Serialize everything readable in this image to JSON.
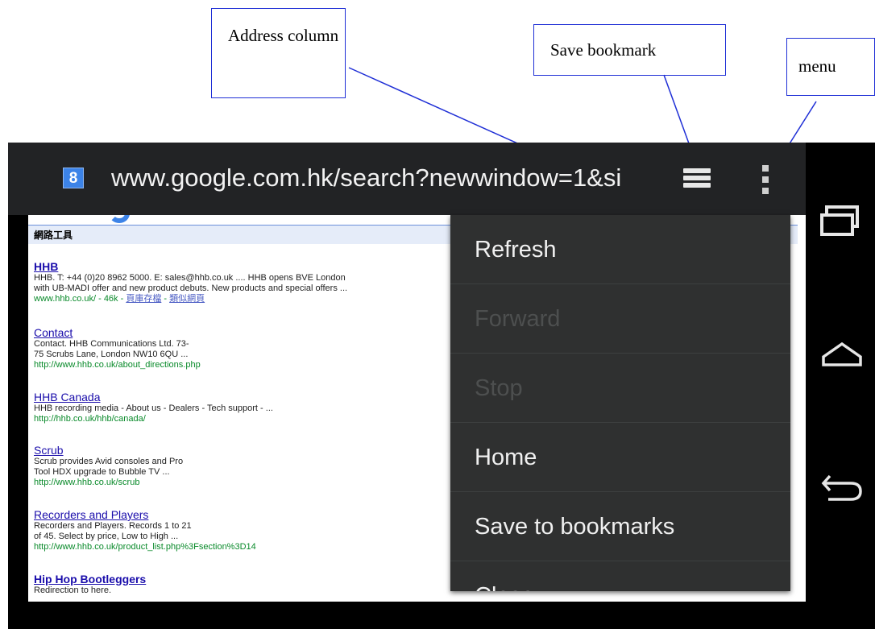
{
  "annotations": {
    "address": "Address column",
    "save": "Save bookmark",
    "menu": "menu"
  },
  "toolbar": {
    "favicon_text": "8",
    "url": "www.google.com.hk/search?newwindow=1&si"
  },
  "page": {
    "tools_label": "網路工具",
    "results": [
      {
        "title": "HHB",
        "snippet_1": "HHB. T: +44 (0)20 8962 5000. E: sales@hhb.co.uk .... HHB opens BVE London",
        "snippet_2": "with UB-MADI offer and new product debuts. New products and special offers ...",
        "url": "www.hhb.co.uk/ - 46k - ",
        "cache": "頁庫存檔",
        "sep": " - ",
        "similar": "類似網頁"
      },
      {
        "title": "Contact",
        "snippet_1": "Contact. HHB Communications Ltd. 73-",
        "snippet_2": "75 Scrubs Lane, London NW10 6QU ...",
        "url": "http://www.hhb.co.uk/about_directions.php"
      },
      {
        "title": "HHB Canada",
        "snippet_1": "HHB recording media - About us - Dealers - Tech support - ...",
        "url": "http://hhb.co.uk/hhb/canada/"
      },
      {
        "title": "Scrub",
        "snippet_1": "Scrub provides Avid consoles and Pro",
        "snippet_2": "Tool HDX upgrade to Bubble TV ...",
        "url": "http://www.hhb.co.uk/scrub"
      },
      {
        "title": "Recorders and Players",
        "snippet_1": "Recorders and Players. Records 1 to 21",
        "snippet_2": "of 45. Select by price, Low to High ...",
        "url": "http://www.hhb.co.uk/product_list.php%3Fsection%3D14"
      },
      {
        "title": "Hip Hop Bootleggers",
        "snippet_1": "Redirection to here."
      }
    ]
  },
  "menu": {
    "items": [
      "Refresh",
      "Forward",
      "Stop",
      "Home",
      "Save to bookmarks",
      "Close"
    ]
  }
}
